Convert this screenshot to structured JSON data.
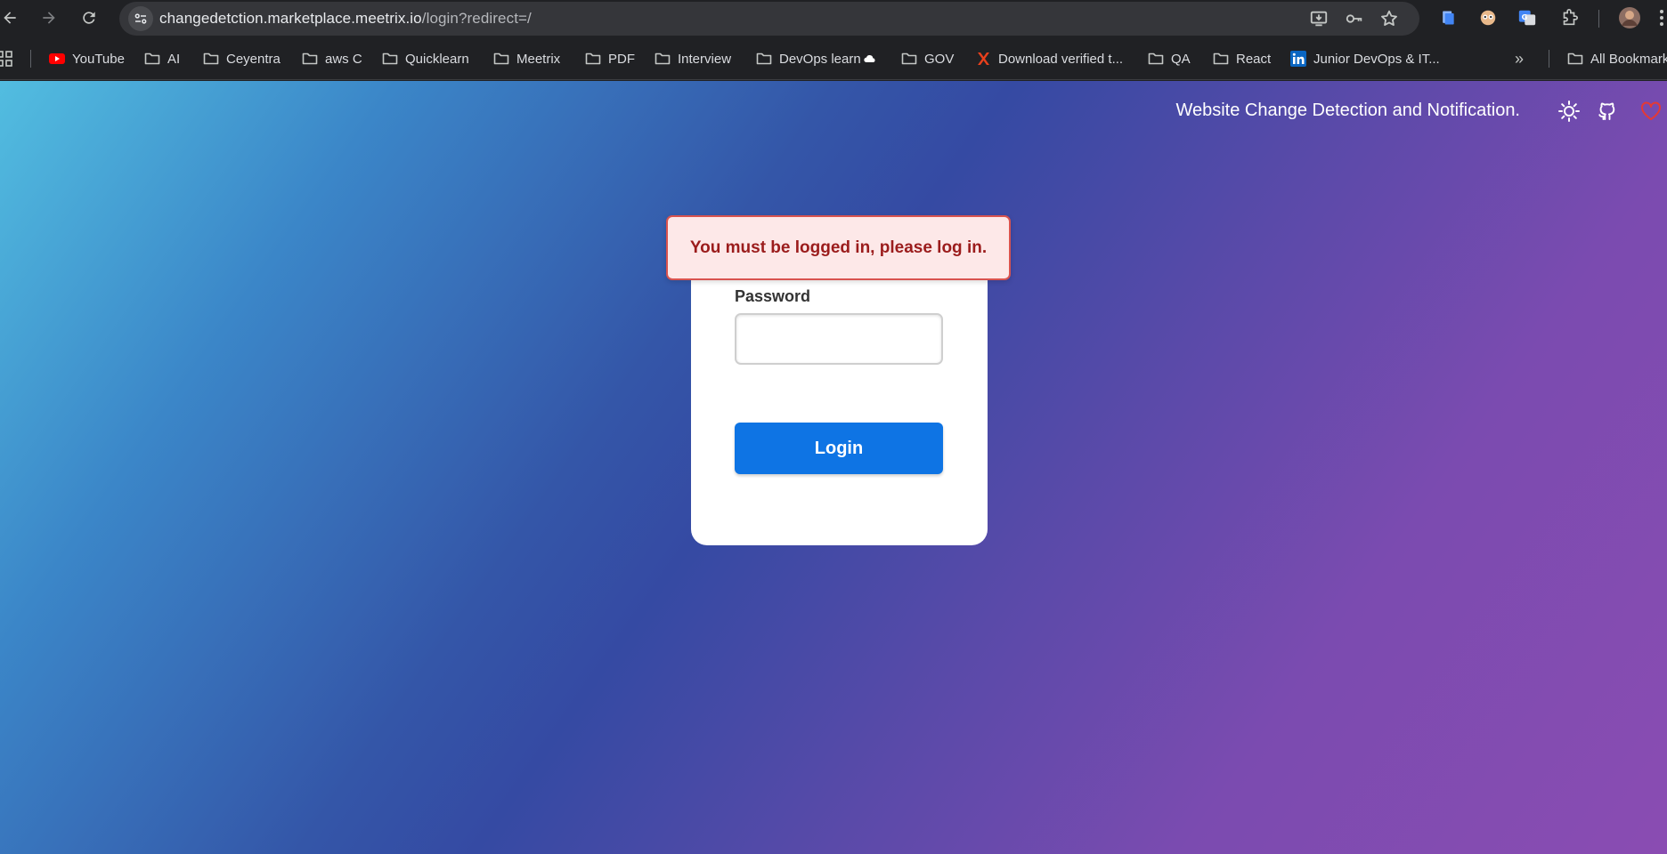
{
  "browser": {
    "url_host": "changedetction.marketplace.meetrix.io",
    "url_path": "/login?redirect=/",
    "bookmarks": [
      {
        "label": "YouTube",
        "icon": "youtube-icon"
      },
      {
        "label": "AI",
        "icon": "folder-icon"
      },
      {
        "label": "Ceyentra",
        "icon": "folder-icon"
      },
      {
        "label": "aws C",
        "icon": "folder-icon"
      },
      {
        "label": "Quicklearn",
        "icon": "folder-icon"
      },
      {
        "label": "Meetrix",
        "icon": "folder-icon"
      },
      {
        "label": "PDF",
        "icon": "folder-icon"
      },
      {
        "label": "Interview",
        "icon": "folder-icon"
      },
      {
        "label": "DevOps learn",
        "icon": "folder-icon"
      },
      {
        "label": "GOV",
        "icon": "folder-icon"
      },
      {
        "label": "Download verified t...",
        "icon": "x-logo-icon"
      },
      {
        "label": "QA",
        "icon": "folder-icon"
      },
      {
        "label": "React",
        "icon": "folder-icon"
      },
      {
        "label": "Junior DevOps & IT...",
        "icon": "linkedin-icon"
      }
    ],
    "overflow_label": "»",
    "all_bookmarks_label": "All Bookmarks",
    "colors": {
      "chrome_bg": "#202124",
      "omnibox_bg": "#35363a"
    }
  },
  "header": {
    "tagline": "Website Change Detection and Notification.",
    "icons": [
      "sun-icon",
      "github-icon",
      "heart-icon"
    ]
  },
  "login": {
    "flash_message": "You must be logged in, please log in.",
    "password_label": "Password",
    "password_value": "",
    "login_button": "Login",
    "colors": {
      "button": "#0e74e4",
      "flash_bg": "#fde8e8",
      "flash_border": "#d9534f",
      "flash_text": "#9b1c1c"
    }
  }
}
